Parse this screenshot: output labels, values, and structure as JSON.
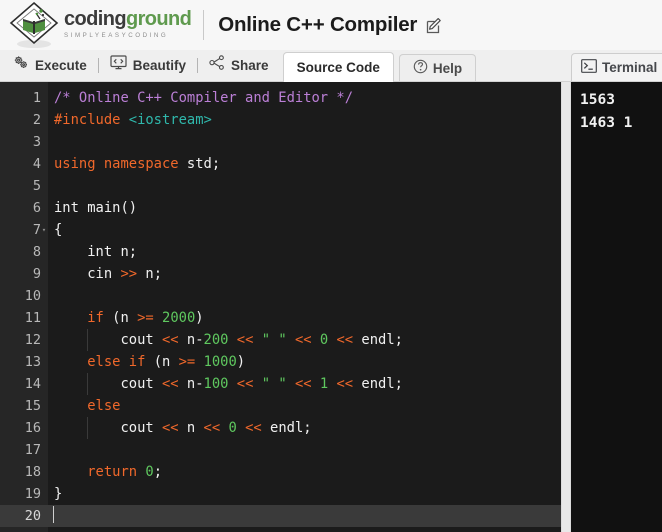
{
  "header": {
    "logo": {
      "word_part1": "coding",
      "word_part2": "ground",
      "tagline": "SIMPLYEASYCODING",
      "mark_icon": "book-diamond-logo-icon"
    },
    "title": "Online C++ Compiler",
    "edit_icon": "edit-pencil-icon"
  },
  "toolbar": {
    "actions": [
      {
        "label": "Execute",
        "icon": "gears-icon"
      },
      {
        "label": "Beautify",
        "icon": "monitor-code-icon"
      },
      {
        "label": "Share",
        "icon": "share-nodes-icon"
      }
    ],
    "tabs": [
      {
        "label": "Source Code",
        "active": true,
        "icon": ""
      },
      {
        "label": "Help",
        "active": false,
        "icon": "question-circle-icon"
      }
    ],
    "terminal_tab": {
      "label": "Terminal",
      "icon": "terminal-prompt-icon"
    }
  },
  "editor": {
    "current_line": 20,
    "total_lines": 20,
    "lines": [
      {
        "n": 1,
        "fold": false,
        "tokens": [
          {
            "t": "/* Online C++ Compiler and Editor */",
            "c": "t-com"
          }
        ]
      },
      {
        "n": 2,
        "fold": false,
        "tokens": [
          {
            "t": "#include ",
            "c": "t-pre"
          },
          {
            "t": "<iostream>",
            "c": "t-inc"
          }
        ]
      },
      {
        "n": 3,
        "fold": false,
        "tokens": []
      },
      {
        "n": 4,
        "fold": false,
        "tokens": [
          {
            "t": "using namespace ",
            "c": "t-kw"
          },
          {
            "t": "std;",
            "c": "t-pln"
          }
        ]
      },
      {
        "n": 5,
        "fold": false,
        "tokens": []
      },
      {
        "n": 6,
        "fold": false,
        "tokens": [
          {
            "t": "int main()",
            "c": "t-pln"
          }
        ]
      },
      {
        "n": 7,
        "fold": true,
        "tokens": [
          {
            "t": "{",
            "c": "t-pln"
          }
        ]
      },
      {
        "n": 8,
        "fold": false,
        "tokens": [
          {
            "t": "    int n;",
            "c": "t-pln"
          }
        ]
      },
      {
        "n": 9,
        "fold": false,
        "tokens": [
          {
            "t": "    cin ",
            "c": "t-pln"
          },
          {
            "t": ">>",
            "c": "t-op"
          },
          {
            "t": " n;",
            "c": "t-pln"
          }
        ]
      },
      {
        "n": 10,
        "fold": false,
        "tokens": []
      },
      {
        "n": 11,
        "fold": false,
        "tokens": [
          {
            "t": "    ",
            "c": "t-pln"
          },
          {
            "t": "if",
            "c": "t-kw"
          },
          {
            "t": " (n ",
            "c": "t-pln"
          },
          {
            "t": ">=",
            "c": "t-op"
          },
          {
            "t": " ",
            "c": "t-pln"
          },
          {
            "t": "2000",
            "c": "t-num"
          },
          {
            "t": ")",
            "c": "t-pln"
          }
        ]
      },
      {
        "n": 12,
        "fold": false,
        "tokens": [
          {
            "t": "        cout ",
            "c": "t-pln"
          },
          {
            "t": "<<",
            "c": "t-op"
          },
          {
            "t": " n-",
            "c": "t-pln"
          },
          {
            "t": "200",
            "c": "t-num"
          },
          {
            "t": " ",
            "c": "t-pln"
          },
          {
            "t": "<<",
            "c": "t-op"
          },
          {
            "t": " ",
            "c": "t-pln"
          },
          {
            "t": "\" \"",
            "c": "t-str"
          },
          {
            "t": " ",
            "c": "t-pln"
          },
          {
            "t": "<<",
            "c": "t-op"
          },
          {
            "t": " ",
            "c": "t-pln"
          },
          {
            "t": "0",
            "c": "t-num"
          },
          {
            "t": " ",
            "c": "t-pln"
          },
          {
            "t": "<<",
            "c": "t-op"
          },
          {
            "t": " endl;",
            "c": "t-pln"
          }
        ]
      },
      {
        "n": 13,
        "fold": false,
        "tokens": [
          {
            "t": "    ",
            "c": "t-pln"
          },
          {
            "t": "else if",
            "c": "t-kw"
          },
          {
            "t": " (n ",
            "c": "t-pln"
          },
          {
            "t": ">=",
            "c": "t-op"
          },
          {
            "t": " ",
            "c": "t-pln"
          },
          {
            "t": "1000",
            "c": "t-num"
          },
          {
            "t": ")",
            "c": "t-pln"
          }
        ]
      },
      {
        "n": 14,
        "fold": false,
        "tokens": [
          {
            "t": "        cout ",
            "c": "t-pln"
          },
          {
            "t": "<<",
            "c": "t-op"
          },
          {
            "t": " n-",
            "c": "t-pln"
          },
          {
            "t": "100",
            "c": "t-num"
          },
          {
            "t": " ",
            "c": "t-pln"
          },
          {
            "t": "<<",
            "c": "t-op"
          },
          {
            "t": " ",
            "c": "t-pln"
          },
          {
            "t": "\" \"",
            "c": "t-str"
          },
          {
            "t": " ",
            "c": "t-pln"
          },
          {
            "t": "<<",
            "c": "t-op"
          },
          {
            "t": " ",
            "c": "t-pln"
          },
          {
            "t": "1",
            "c": "t-num"
          },
          {
            "t": " ",
            "c": "t-pln"
          },
          {
            "t": "<<",
            "c": "t-op"
          },
          {
            "t": " endl;",
            "c": "t-pln"
          }
        ]
      },
      {
        "n": 15,
        "fold": false,
        "tokens": [
          {
            "t": "    ",
            "c": "t-pln"
          },
          {
            "t": "else",
            "c": "t-kw"
          }
        ]
      },
      {
        "n": 16,
        "fold": false,
        "tokens": [
          {
            "t": "        cout ",
            "c": "t-pln"
          },
          {
            "t": "<<",
            "c": "t-op"
          },
          {
            "t": " n ",
            "c": "t-pln"
          },
          {
            "t": "<<",
            "c": "t-op"
          },
          {
            "t": " ",
            "c": "t-pln"
          },
          {
            "t": "0",
            "c": "t-num"
          },
          {
            "t": " ",
            "c": "t-pln"
          },
          {
            "t": "<<",
            "c": "t-op"
          },
          {
            "t": " endl;",
            "c": "t-pln"
          }
        ]
      },
      {
        "n": 17,
        "fold": false,
        "tokens": []
      },
      {
        "n": 18,
        "fold": false,
        "tokens": [
          {
            "t": "    ",
            "c": "t-pln"
          },
          {
            "t": "return",
            "c": "t-kw"
          },
          {
            "t": " ",
            "c": "t-pln"
          },
          {
            "t": "0",
            "c": "t-num"
          },
          {
            "t": ";",
            "c": "t-pln"
          }
        ]
      },
      {
        "n": 19,
        "fold": false,
        "tokens": [
          {
            "t": "}",
            "c": "t-pln"
          }
        ]
      },
      {
        "n": 20,
        "fold": false,
        "tokens": []
      }
    ]
  },
  "terminal": {
    "output_lines": [
      "1563",
      "1463 1"
    ]
  },
  "colors": {
    "brand_green": "#5f9a4e",
    "brand_gray": "#3b3b3b",
    "editor_bg": "#1b1b1b",
    "gutter_bg": "#262626",
    "active_line_bg": "#3a3a3a",
    "terminal_bg": "#111111",
    "keyword": "#f0682b",
    "comment": "#bb7fd6",
    "number": "#5fc85f",
    "string": "#5fc85f",
    "include": "#2fb7ab"
  }
}
